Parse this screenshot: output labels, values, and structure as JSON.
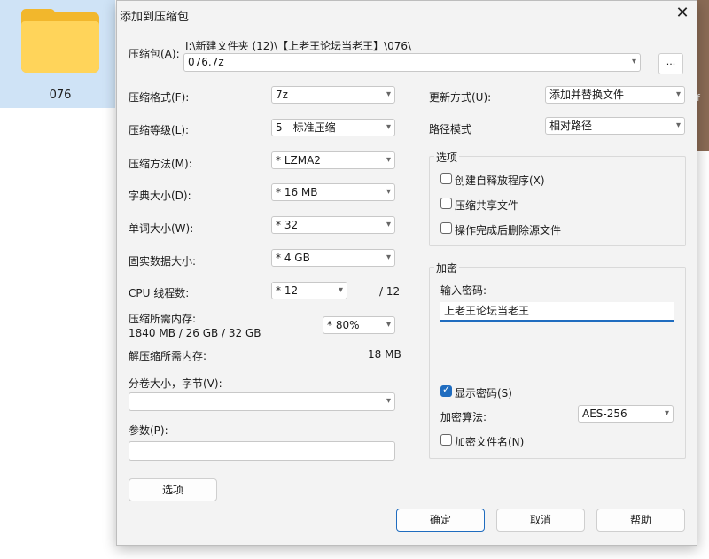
{
  "desktop": {
    "folder_label": "076",
    "edge_char": "f"
  },
  "dialog": {
    "title": "添加到压缩包",
    "archive_label": "压缩包(A):",
    "archive_path": "I:\\新建文件夹 (12)\\【上老王论坛当老王】\\076\\",
    "archive_name": "076.7z",
    "browse_label": "...",
    "left": {
      "format_label": "压缩格式(F):",
      "format_value": "7z",
      "level_label": "压缩等级(L):",
      "level_value": "5 - 标准压缩",
      "method_label": "压缩方法(M):",
      "method_value": "* LZMA2",
      "dict_label": "字典大小(D):",
      "dict_value": "* 16 MB",
      "word_label": "单词大小(W):",
      "word_value": "* 32",
      "solid_label": "固实数据大小:",
      "solid_value": "* 4 GB",
      "threads_label": "CPU 线程数:",
      "threads_value": "* 12",
      "threads_max": "/ 12",
      "mem_label": "压缩所需内存:",
      "mem_value": "1840 MB / 26 GB / 32 GB",
      "mem_percent": "* 80%",
      "decomp_label": "解压缩所需内存:",
      "decomp_value": "18 MB",
      "volume_label": "分卷大小，字节(V):",
      "volume_value": "",
      "params_label": "参数(P):",
      "params_value": "",
      "options_button": "选项"
    },
    "right": {
      "update_label": "更新方式(U):",
      "update_value": "添加并替换文件",
      "path_label": "路径模式",
      "path_value": "相对路径",
      "options_group": "选项",
      "opt_sfx": "创建自释放程序(X)",
      "opt_shared": "压缩共享文件",
      "opt_delete": "操作完成后删除源文件",
      "encrypt_group": "加密",
      "pwd_label": "输入密码:",
      "pwd_value": "上老王论坛当老王",
      "show_pwd": "显示密码(S)",
      "algo_label": "加密算法:",
      "algo_value": "AES-256",
      "encrypt_names": "加密文件名(N)"
    },
    "buttons": {
      "ok": "确定",
      "cancel": "取消",
      "help": "帮助"
    }
  }
}
